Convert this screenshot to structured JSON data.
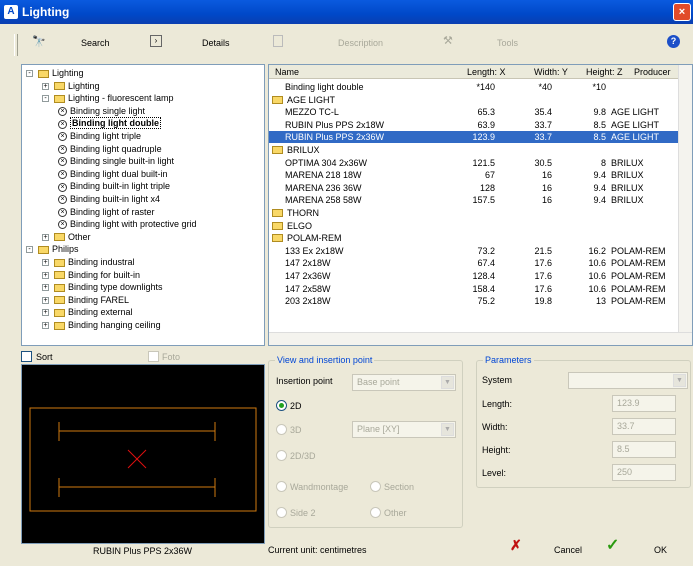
{
  "window": {
    "title": "Lighting",
    "close_glyph": "×"
  },
  "toolbar": {
    "search_label": "Search",
    "details_label": "Details",
    "description_label": "Description",
    "tools_label": "Tools",
    "help_glyph": "?"
  },
  "tree": [
    {
      "label": "Lighting",
      "level": 0,
      "kind": "folder",
      "expander": "-"
    },
    {
      "label": "Lighting",
      "level": 1,
      "kind": "folder",
      "expander": "+"
    },
    {
      "label": "Lighting - fluorescent lamp",
      "level": 1,
      "kind": "folder",
      "expander": "-"
    },
    {
      "label": "Binding single light",
      "level": 2,
      "kind": "lamp"
    },
    {
      "label": "Binding light double",
      "level": 2,
      "kind": "lamp",
      "selected": true
    },
    {
      "label": "Binding light triple",
      "level": 2,
      "kind": "lamp"
    },
    {
      "label": "Binding light quadruple",
      "level": 2,
      "kind": "lamp"
    },
    {
      "label": "Binding single built-in light",
      "level": 2,
      "kind": "lamp"
    },
    {
      "label": "Binding light dual built-in",
      "level": 2,
      "kind": "lamp"
    },
    {
      "label": "Binding built-in light triple",
      "level": 2,
      "kind": "lamp"
    },
    {
      "label": "Binding built-in light x4",
      "level": 2,
      "kind": "lamp"
    },
    {
      "label": "Binding light of raster",
      "level": 2,
      "kind": "lamp"
    },
    {
      "label": "Binding light with protective grid",
      "level": 2,
      "kind": "lamp"
    },
    {
      "label": "Other",
      "level": 1,
      "kind": "folder",
      "expander": "+"
    },
    {
      "label": "Philips",
      "level": 0,
      "kind": "folder",
      "expander": "-"
    },
    {
      "label": "Binding industral",
      "level": 1,
      "kind": "folder",
      "expander": "+"
    },
    {
      "label": "Binding for built-in",
      "level": 1,
      "kind": "folder",
      "expander": "+"
    },
    {
      "label": "Binding type downlights",
      "level": 1,
      "kind": "folder",
      "expander": "+"
    },
    {
      "label": "Binding FAREL",
      "level": 1,
      "kind": "folder",
      "expander": "+"
    },
    {
      "label": "Binding external",
      "level": 1,
      "kind": "folder",
      "expander": "+"
    },
    {
      "label": "Binding hanging ceiling",
      "level": 1,
      "kind": "folder",
      "expander": "+"
    }
  ],
  "grid": {
    "columns": [
      "Name",
      "Length: X",
      "Width: Y",
      "Height: Z",
      "Producer"
    ],
    "rows": [
      {
        "kind": "item",
        "name": "Binding light double",
        "x": "*140",
        "y": "*40",
        "z": "*10",
        "p": ""
      },
      {
        "kind": "group",
        "name": "AGE LIGHT"
      },
      {
        "kind": "item",
        "name": "MEZZO TC-L",
        "x": "65.3",
        "y": "35.4",
        "z": "9.8",
        "p": "AGE LIGHT"
      },
      {
        "kind": "item",
        "name": "RUBIN Plus PPS 2x18W",
        "x": "63.9",
        "y": "33.7",
        "z": "8.5",
        "p": "AGE LIGHT"
      },
      {
        "kind": "item",
        "name": "RUBIN Plus PPS 2x36W",
        "x": "123.9",
        "y": "33.7",
        "z": "8.5",
        "p": "AGE LIGHT",
        "selected": true
      },
      {
        "kind": "group",
        "name": "BRILUX"
      },
      {
        "kind": "item",
        "name": "OPTIMA 304 2x36W",
        "x": "121.5",
        "y": "30.5",
        "z": "8",
        "p": "BRILUX"
      },
      {
        "kind": "item",
        "name": "MARENA 218 18W",
        "x": "67",
        "y": "16",
        "z": "9.4",
        "p": "BRILUX"
      },
      {
        "kind": "item",
        "name": "MARENA 236 36W",
        "x": "128",
        "y": "16",
        "z": "9.4",
        "p": "BRILUX"
      },
      {
        "kind": "item",
        "name": "MARENA 258 58W",
        "x": "157.5",
        "y": "16",
        "z": "9.4",
        "p": "BRILUX"
      },
      {
        "kind": "group",
        "name": "THORN"
      },
      {
        "kind": "group",
        "name": "ELGO"
      },
      {
        "kind": "group",
        "name": "POLAM-REM"
      },
      {
        "kind": "item",
        "name": "133 Ex 2x18W",
        "x": "73.2",
        "y": "21.5",
        "z": "16.2",
        "p": "POLAM-REM"
      },
      {
        "kind": "item",
        "name": "147 2x18W",
        "x": "67.4",
        "y": "17.6",
        "z": "10.6",
        "p": "POLAM-REM"
      },
      {
        "kind": "item",
        "name": "147 2x36W",
        "x": "128.4",
        "y": "17.6",
        "z": "10.6",
        "p": "POLAM-REM"
      },
      {
        "kind": "item",
        "name": "147 2x58W",
        "x": "158.4",
        "y": "17.6",
        "z": "10.6",
        "p": "POLAM-REM"
      },
      {
        "kind": "item",
        "name": "203 2x18W",
        "x": "75.2",
        "y": "19.8",
        "z": "13",
        "p": "POLAM-REM"
      }
    ]
  },
  "sort_label": "Sort",
  "foto_label": "Foto",
  "preview_caption": "RUBIN Plus PPS 2x36W",
  "view": {
    "title": "View and insertion point",
    "insertion_label": "Insertion point",
    "insertion_value": "Base point",
    "opt_2d": "2D",
    "opt_3d": "3D",
    "plane_value": "Plane [XY]",
    "opt_2d3d": "2D/3D",
    "opt_wand": "Wandmontage",
    "opt_section": "Section",
    "opt_side2": "Side 2",
    "opt_other": "Other"
  },
  "params": {
    "title": "Parameters",
    "system_label": "System",
    "system_value": "",
    "length_label": "Length:",
    "length_value": "123.9",
    "width_label": "Width:",
    "width_value": "33.7",
    "height_label": "Height:",
    "height_value": "8.5",
    "level_label": "Level:",
    "level_value": "250"
  },
  "footer": {
    "unit_text": "Current unit: centimetres",
    "cancel_label": "Cancel",
    "ok_label": "OK"
  }
}
